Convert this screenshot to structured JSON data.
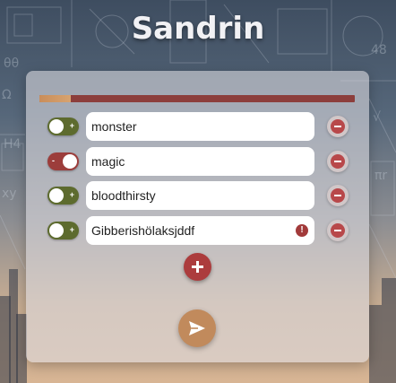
{
  "app": {
    "title": "Sandrin"
  },
  "progress": {
    "value_percent": 10
  },
  "rows": [
    {
      "text": "monster",
      "enabled": true,
      "toggle_symbol": "+",
      "has_warning": false
    },
    {
      "text": "magic",
      "enabled": false,
      "toggle_symbol": "-",
      "has_warning": false
    },
    {
      "text": "bloodthirsty",
      "enabled": true,
      "toggle_symbol": "+",
      "has_warning": false
    },
    {
      "text": "Gibberishölaksjddf",
      "enabled": true,
      "toggle_symbol": "+",
      "has_warning": true
    }
  ],
  "warning_symbol": "!",
  "icons": {
    "remove": "minus-circle-icon",
    "add": "plus-icon",
    "send": "paper-plane-icon",
    "warning": "exclamation-icon"
  },
  "colors": {
    "toggle_on": "#5d6b2e",
    "toggle_off": "#9c3d3b",
    "add_button": "#ac3c3d",
    "send_button": "#c18a5c",
    "progress_fill": "#d7a370",
    "progress_track": "#8c3e3c"
  }
}
